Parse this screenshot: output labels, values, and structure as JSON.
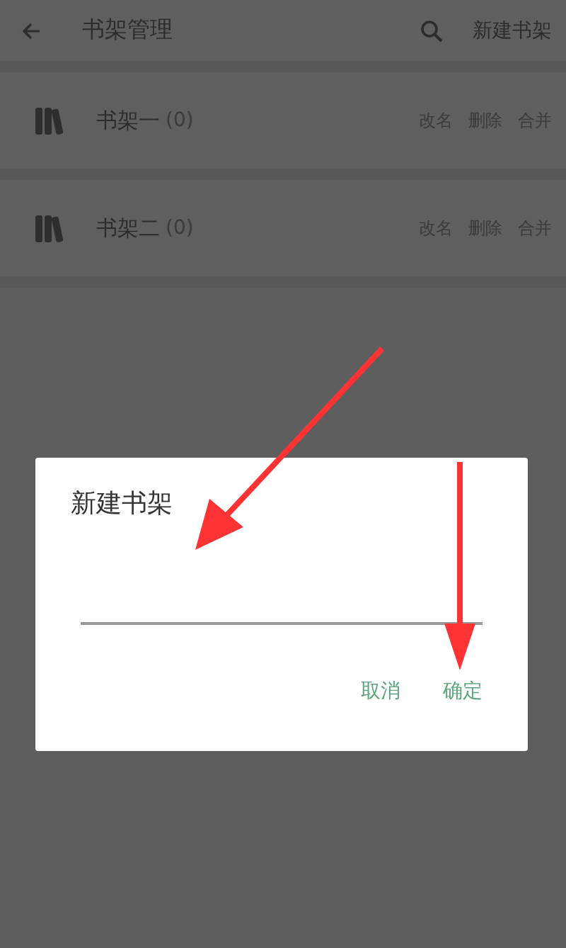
{
  "app_bar": {
    "title": "书架管理",
    "action": "新建书架"
  },
  "shelves": [
    {
      "name": "书架一",
      "count": "(0)",
      "actions": [
        "改名",
        "删除",
        "合并"
      ]
    },
    {
      "name": "书架二",
      "count": "(0)",
      "actions": [
        "改名",
        "删除",
        "合并"
      ]
    }
  ],
  "dialog": {
    "title": "新建书架",
    "buttons": [
      "取消",
      "确定"
    ]
  }
}
